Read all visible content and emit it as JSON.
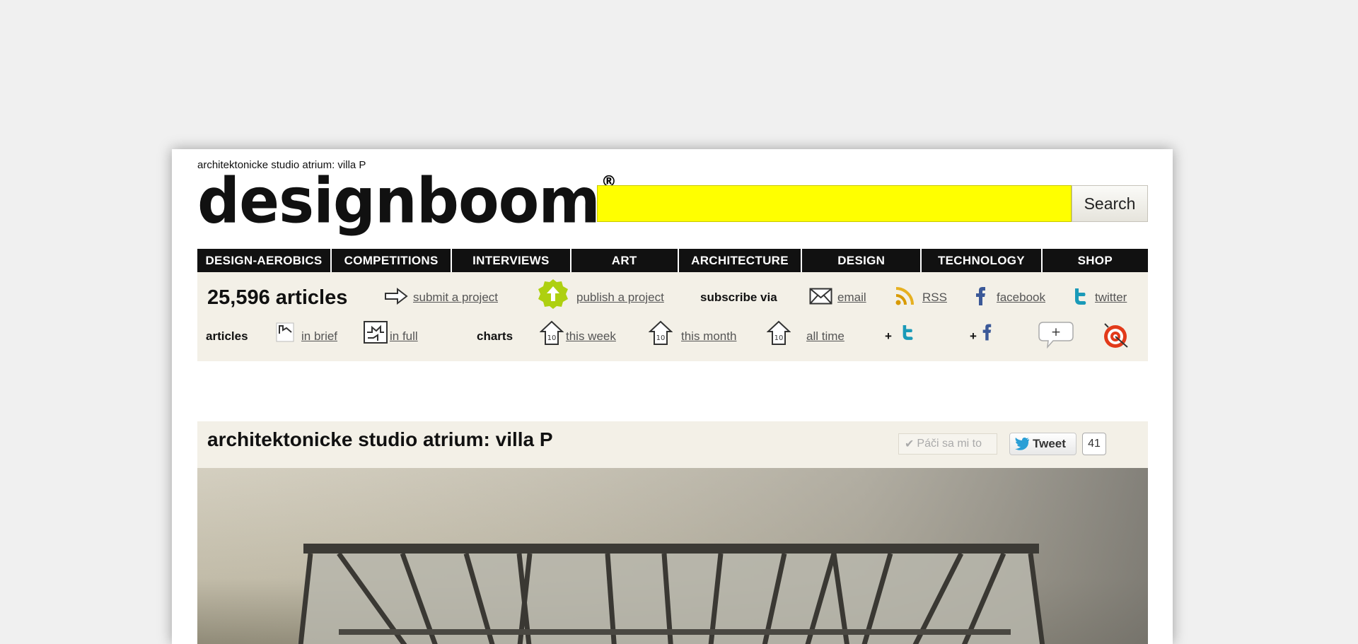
{
  "page": {
    "pretitle": "architektonicke studio atrium: villa P",
    "logo": "designboom",
    "logo_mark": "®"
  },
  "search": {
    "value": "",
    "placeholder": "",
    "button_label": "Search"
  },
  "nav": {
    "items": [
      {
        "label": "DESIGN-AEROBICS"
      },
      {
        "label": "COMPETITIONS"
      },
      {
        "label": "INTERVIEWS"
      },
      {
        "label": "ART"
      },
      {
        "label": "ARCHITECTURE"
      },
      {
        "label": "DESIGN"
      },
      {
        "label": "TECHNOLOGY"
      },
      {
        "label": "SHOP"
      }
    ]
  },
  "toolbar": {
    "articles_count": "25,596 articles",
    "submit": "submit a project",
    "publish": "publish a project",
    "subscribe_label": "subscribe via",
    "email": "email",
    "rss": "RSS",
    "facebook": "facebook",
    "twitter": "twitter",
    "articles_label": "articles",
    "in_brief": "in brief",
    "in_full": "in full",
    "charts_label": "charts",
    "this_week": "this week",
    "this_month": "this month",
    "all_time": "all time",
    "plus": "+",
    "top10": "10"
  },
  "article": {
    "title": "architektonicke studio atrium: villa P",
    "like_label": "Páči sa mi to",
    "tweet_label": "Tweet",
    "tweet_count": "41"
  },
  "colors": {
    "search_bg": "#ffff00",
    "nav_bg": "#111111",
    "toolbar_bg": "#f3f0e7",
    "facebook": "#3b5998",
    "twitter": "#1a9ab8"
  }
}
